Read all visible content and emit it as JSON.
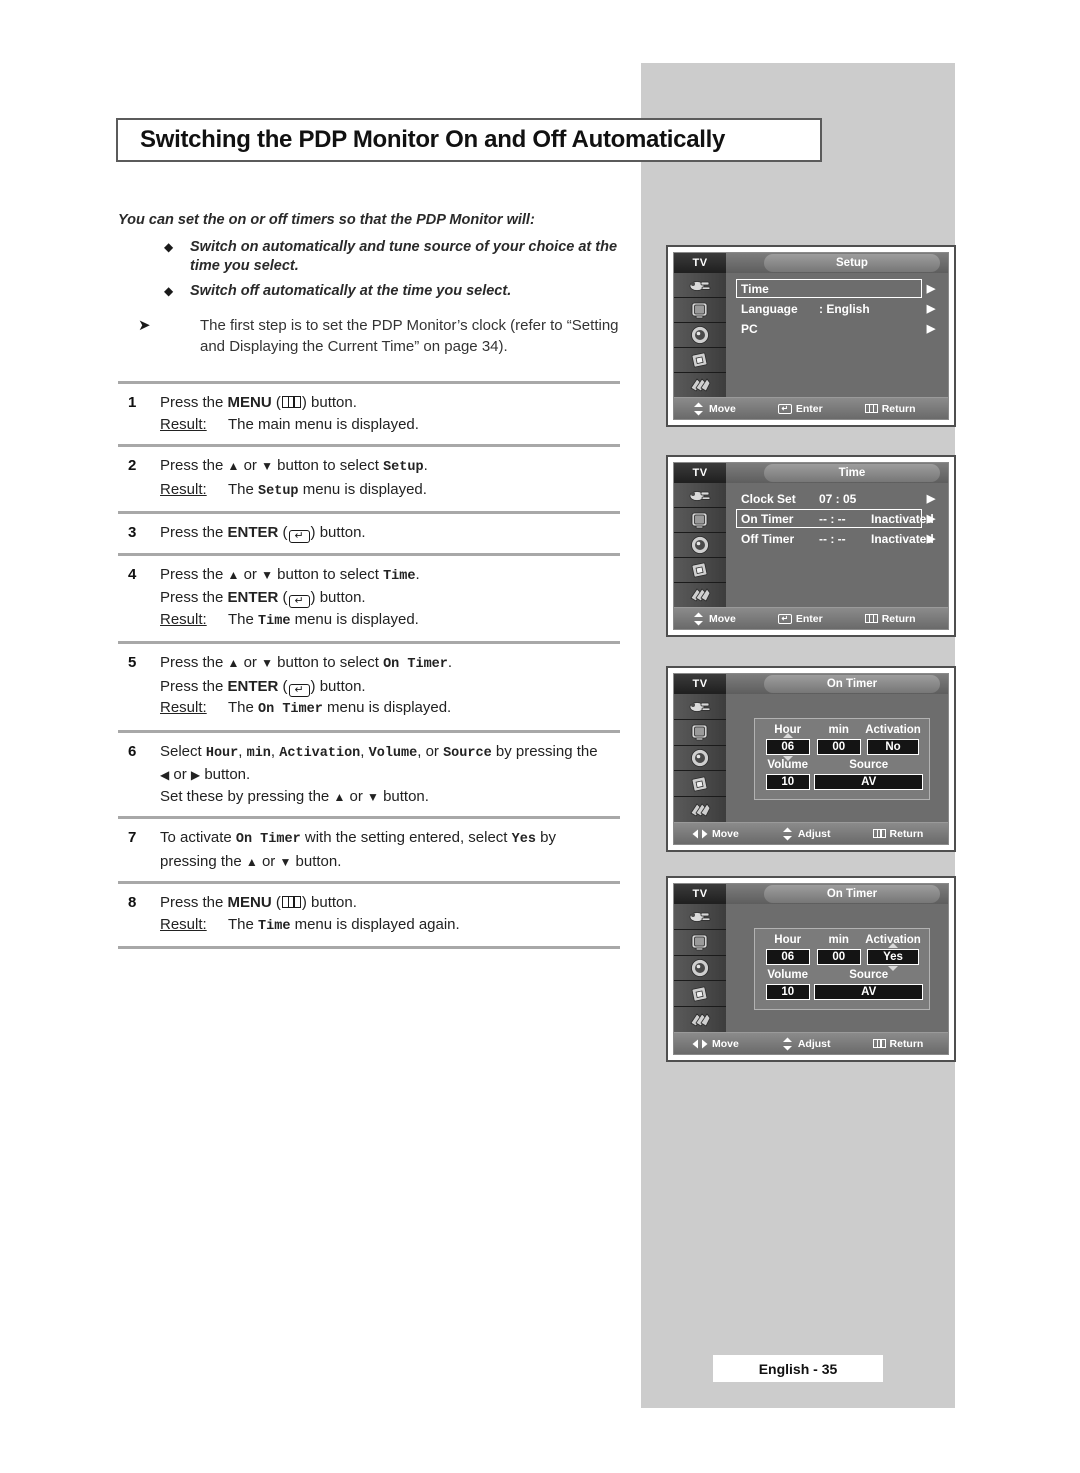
{
  "page": {
    "title": "Switching the PDP Monitor On and Off Automatically",
    "footer_badge": "English - 35"
  },
  "intro": {
    "lead": "You can set the on or off timers so that the PDP Monitor will:",
    "bullets": [
      "Switch on automatically and tune source of your choice at the time you select.",
      "Switch off automatically at the time you select."
    ],
    "note": "The first step is to set the PDP Monitor’s clock (refer to “Setting and Displaying the Current Time” on page 34)."
  },
  "steps": [
    {
      "num": "1",
      "lines": [
        {
          "type": "text",
          "pre": "Press the ",
          "strong": "MENU",
          "icon": "menu",
          "post": " button."
        }
      ],
      "result": {
        "label": "Result:",
        "pre": "The main menu is displayed.",
        "mono": "",
        "post": ""
      }
    },
    {
      "num": "2",
      "lines": [
        {
          "type": "updown",
          "pre": "Press the ",
          "mid": " or ",
          "post": " button to select ",
          "mono": "Setup",
          "tail": "."
        }
      ],
      "result": {
        "label": "Result:",
        "pre": "The ",
        "mono": "Setup",
        "post": " menu is displayed."
      }
    },
    {
      "num": "3",
      "lines": [
        {
          "type": "text",
          "pre": "Press the ",
          "strong": "ENTER",
          "icon": "enter",
          "post": " button."
        }
      ],
      "result": null
    },
    {
      "num": "4",
      "lines": [
        {
          "type": "updown",
          "pre": "Press the ",
          "mid": " or ",
          "post": " button to select ",
          "mono": "Time",
          "tail": "."
        },
        {
          "type": "text",
          "pre": "Press the ",
          "strong": "ENTER",
          "icon": "enter",
          "post": " button."
        }
      ],
      "result": {
        "label": "Result:",
        "pre": "The ",
        "mono": "Time",
        "post": " menu is displayed."
      }
    },
    {
      "num": "5",
      "lines": [
        {
          "type": "updown",
          "pre": "Press the ",
          "mid": " or ",
          "post": " button to select ",
          "mono": "On Timer",
          "tail": "."
        },
        {
          "type": "text",
          "pre": "Press the ",
          "strong": "ENTER",
          "icon": "enter",
          "post": " button."
        }
      ],
      "result": {
        "label": "Result:",
        "pre": "The ",
        "mono": "On Timer",
        "post": " menu is displayed."
      }
    },
    {
      "num": "6",
      "lines": [
        {
          "type": "select6"
        },
        {
          "type": "leftright"
        },
        {
          "type": "setthese"
        }
      ],
      "result": null
    },
    {
      "num": "7",
      "lines": [
        {
          "type": "activate7"
        }
      ],
      "result": null
    },
    {
      "num": "8",
      "lines": [
        {
          "type": "text",
          "pre": "Press the ",
          "strong": "MENU",
          "icon": "menu",
          "post": " button."
        }
      ],
      "result": {
        "label": "Result:",
        "pre": "The ",
        "mono": "Time",
        "post": " menu is displayed again."
      }
    }
  ],
  "step_text": {
    "press_the": "Press the ",
    "or": " or ",
    "button_to_select": " button to select ",
    "button_period": " button.",
    "period": ".",
    "result_label": "Result:",
    "the": "The ",
    "menu_displayed": " menu is displayed.",
    "menu_displayed_again": " menu is displayed again.",
    "main_menu_displayed": "The main menu is displayed.",
    "select": "Select ",
    "comma": ", ",
    "or_word": ", or ",
    "by_pressing_the": " by pressing the ",
    "set_these_by_pressing": "Set these by pressing the ",
    "to_activate": "To activate ",
    "with_setting": " with the setting entered, select ",
    "by_pressing": " by ",
    "pressing_the": "pressing the ",
    "menu_label": "MENU",
    "enter_label": "ENTER",
    "hour": "Hour",
    "min": "min",
    "activation": "Activation",
    "volume": "Volume",
    "source": "Source",
    "on_timer": "On Timer",
    "yes": "Yes",
    "setup": "Setup",
    "time": "Time"
  },
  "osd": {
    "tv_label": "TV",
    "side_icons": [
      "input-antenna-icon",
      "picture-tv-icon",
      "sound-speaker-icon",
      "setup-chip-icon",
      "feature-pages-icon"
    ],
    "screens": [
      {
        "id": "setup-menu",
        "title": "Setup",
        "rows": [
          {
            "label": "Time",
            "value": "",
            "selected": true,
            "arrow": "▶"
          },
          {
            "label": "Language",
            "value": ": English",
            "selected": false,
            "arrow": "▶"
          },
          {
            "label": "PC",
            "value": "",
            "selected": false,
            "arrow": "▶"
          }
        ],
        "hints": [
          {
            "icon": "updown-arrow-icon",
            "label": "Move"
          },
          {
            "icon": "enter-icon",
            "label": "Enter"
          },
          {
            "icon": "menu-icon",
            "label": "Return"
          }
        ]
      },
      {
        "id": "time-menu",
        "title": "Time",
        "rows": [
          {
            "label": "Clock Set",
            "value": "07 : 05",
            "value2": "",
            "selected": false,
            "arrow": "▶"
          },
          {
            "label": "On Timer",
            "value": "-- : --",
            "value2": "Inactivated",
            "selected": true,
            "arrow": "▶"
          },
          {
            "label": "Off Timer",
            "value": "-- : --",
            "value2": "Inactivated",
            "selected": false,
            "arrow": "▶"
          }
        ],
        "hints": [
          {
            "icon": "updown-arrow-icon",
            "label": "Move"
          },
          {
            "icon": "enter-icon",
            "label": "Enter"
          },
          {
            "icon": "menu-icon",
            "label": "Return"
          }
        ]
      },
      {
        "id": "on-timer-no",
        "title": "On Timer",
        "timer": {
          "headers_row1": [
            "Hour",
            "min",
            "Activation"
          ],
          "values_row1": [
            "06",
            "00",
            "No"
          ],
          "spin_on": "hour",
          "headers_row2": [
            "Volume",
            "Source"
          ],
          "values_row2": [
            "10",
            "AV"
          ]
        },
        "hints": [
          {
            "icon": "leftright-arrow-icon",
            "label": "Move"
          },
          {
            "icon": "updown-arrow-icon",
            "label": "Adjust"
          },
          {
            "icon": "menu-icon",
            "label": "Return"
          }
        ]
      },
      {
        "id": "on-timer-yes",
        "title": "On Timer",
        "timer": {
          "headers_row1": [
            "Hour",
            "min",
            "Activation"
          ],
          "values_row1": [
            "06",
            "00",
            "Yes"
          ],
          "spin_on": "activation",
          "headers_row2": [
            "Volume",
            "Source"
          ],
          "values_row2": [
            "10",
            "AV"
          ]
        },
        "hints": [
          {
            "icon": "leftright-arrow-icon",
            "label": "Move"
          },
          {
            "icon": "updown-arrow-icon",
            "label": "Adjust"
          },
          {
            "icon": "menu-icon",
            "label": "Return"
          }
        ]
      }
    ]
  }
}
